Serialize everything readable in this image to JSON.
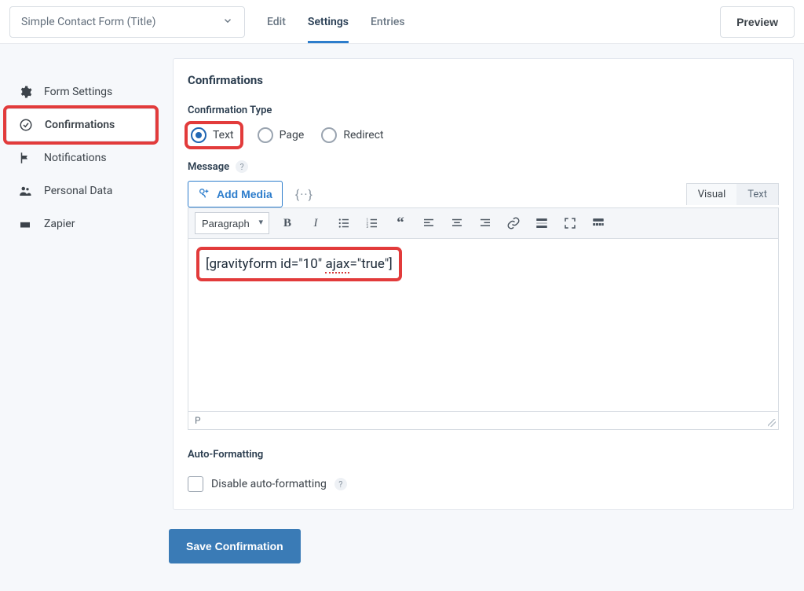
{
  "topbar": {
    "form_selector_label": "Simple Contact Form (Title)",
    "tabs": {
      "edit": "Edit",
      "settings": "Settings",
      "entries": "Entries"
    },
    "preview_label": "Preview"
  },
  "sidebar": {
    "items": [
      {
        "label": "Form Settings"
      },
      {
        "label": "Confirmations"
      },
      {
        "label": "Notifications"
      },
      {
        "label": "Personal Data"
      },
      {
        "label": "Zapier"
      }
    ]
  },
  "panel": {
    "title": "Confirmations",
    "type_label": "Confirmation Type",
    "type_options": {
      "text": "Text",
      "page": "Page",
      "redirect": "Redirect"
    },
    "message_label": "Message",
    "add_media_label": "Add Media",
    "merge_tag_label": "{··}",
    "editor_modes": {
      "visual": "Visual",
      "text": "Text"
    },
    "format_select": "Paragraph",
    "editor_content": "[gravityform id=\"10\" ajax=\"true\"]",
    "status_path": "P",
    "autoformat_heading": "Auto-Formatting",
    "autoformat_checkbox": "Disable auto-formatting"
  },
  "save_label": "Save Confirmation"
}
